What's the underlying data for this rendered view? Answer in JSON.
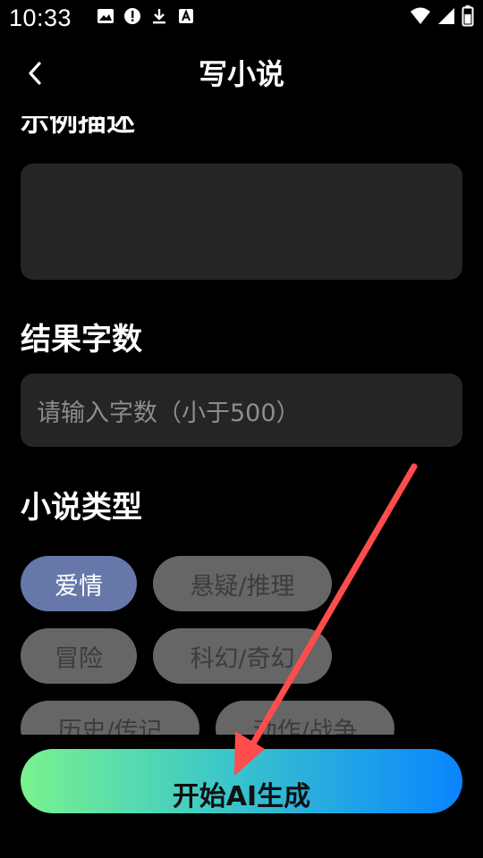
{
  "status_bar": {
    "time": "10:33",
    "left_icons": [
      "image-icon",
      "alert-icon",
      "download-icon",
      "a-icon"
    ],
    "right_icons": [
      "wifi-icon",
      "signal-icon",
      "battery-icon"
    ]
  },
  "header": {
    "title": "写小说"
  },
  "form": {
    "clipped_label": "示例描述",
    "wordcount_label": "结果字数",
    "wordcount_placeholder": "请输入字数（小于500）",
    "genre_label": "小说类型",
    "genres": [
      {
        "label": "爱情",
        "selected": true
      },
      {
        "label": "悬疑/推理",
        "selected": false
      },
      {
        "label": "冒险",
        "selected": false
      },
      {
        "label": "科幻/奇幻",
        "selected": false
      },
      {
        "label": "历史/传记",
        "selected": false
      },
      {
        "label": "动作/战争",
        "selected": false
      }
    ]
  },
  "actions": {
    "generate_label": "开始AI生成"
  },
  "colors": {
    "background": "#000000",
    "field": "#252525",
    "chip": "#666666",
    "chip_selected": "#6677aa",
    "arrow": "#ff4d4d",
    "button_gradient": [
      "#79f28f",
      "#0a84ff"
    ]
  }
}
